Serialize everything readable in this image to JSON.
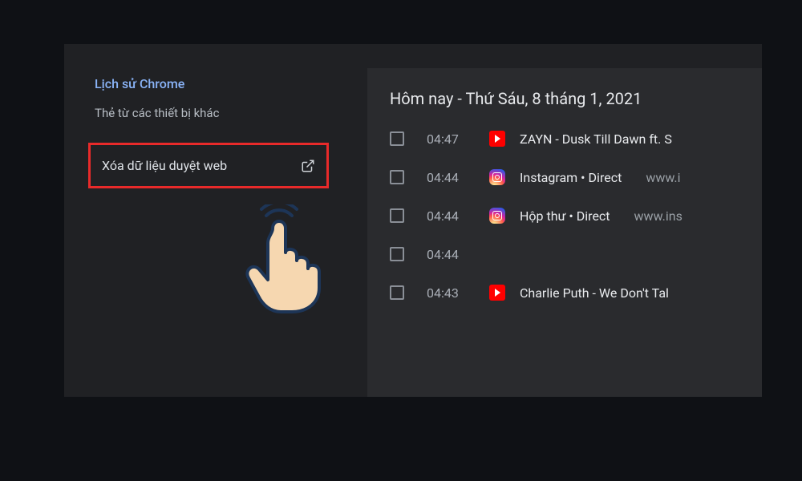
{
  "sidebar": {
    "history_label": "Lịch sử Chrome",
    "tabs_from_other": "Thẻ từ các thiết bị khác",
    "clear_data": "Xóa dữ liệu duyệt web"
  },
  "main": {
    "date_header": "Hôm nay - Thứ Sáu, 8 tháng 1, 2021",
    "rows": [
      {
        "time": "04:47",
        "icon": "youtube",
        "title": "ZAYN - Dusk Till Dawn ft. S",
        "domain": ""
      },
      {
        "time": "04:44",
        "icon": "instagram",
        "title": "Instagram • Direct",
        "domain": "www.i"
      },
      {
        "time": "04:44",
        "icon": "instagram",
        "title": "Hộp thư • Direct",
        "domain": "www.ins"
      },
      {
        "time": "04:44",
        "icon": "",
        "title": "",
        "domain": ""
      },
      {
        "time": "04:43",
        "icon": "youtube",
        "title": "Charlie Puth - We Don't Tal",
        "domain": ""
      }
    ]
  }
}
